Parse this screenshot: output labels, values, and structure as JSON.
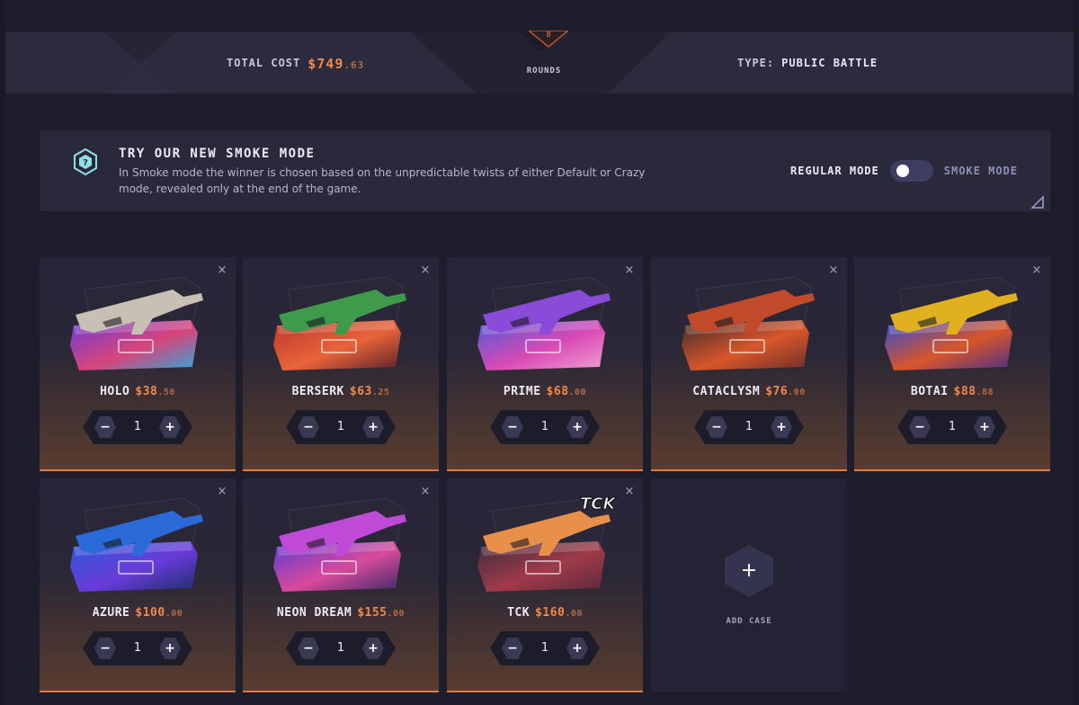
{
  "header": {
    "total_cost_label": "TOTAL COST",
    "total_cost_dollars": "$749",
    "total_cost_cents": ".63",
    "rounds_count": "8",
    "rounds_label": "ROUNDS",
    "type_label": "TYPE:",
    "type_value": "PUBLIC BATTLE"
  },
  "smoke_banner": {
    "title": "TRY OUR NEW SMOKE MODE",
    "description": "In Smoke mode the winner is chosen based on the unpredictable twists of either Default or Crazy mode, revealed only at the end of the game.",
    "regular_mode_label": "REGULAR MODE",
    "smoke_mode_label": "SMOKE MODE",
    "toggle_on": false
  },
  "cases": [
    {
      "name": "HOLO",
      "price": "$38",
      "cents": ".50",
      "qty": "1",
      "remove": "×",
      "minus": "−",
      "plus": "+",
      "crate": [
        "#6a3bd9",
        "#d7457a",
        "#2fa7d8"
      ],
      "gun": "#c8c0b4"
    },
    {
      "name": "BERSERK",
      "price": "$63",
      "cents": ".25",
      "qty": "1",
      "remove": "×",
      "minus": "−",
      "plus": "+",
      "crate": [
        "#b8352a",
        "#e8643a",
        "#5a1f2a"
      ],
      "gun": "#3f9a4b"
    },
    {
      "name": "PRIME",
      "price": "$68",
      "cents": ".00",
      "qty": "1",
      "remove": "×",
      "minus": "−",
      "plus": "+",
      "crate": [
        "#4a5bd8",
        "#d84ab6",
        "#f0a0d0"
      ],
      "gun": "#8a4bd8"
    },
    {
      "name": "CATACLYSM",
      "price": "$76",
      "cents": ".00",
      "qty": "1",
      "remove": "×",
      "minus": "−",
      "plus": "+",
      "crate": [
        "#3a2a2c",
        "#d8562a",
        "#6a2f2a"
      ],
      "gun": "#c04a2a"
    },
    {
      "name": "BOTAI",
      "price": "$88",
      "cents": ".88",
      "qty": "1",
      "remove": "×",
      "minus": "−",
      "plus": "+",
      "crate": [
        "#2a4bd8",
        "#d8562a",
        "#4a2f8a"
      ],
      "gun": "#e0b020"
    },
    {
      "name": "AZURE",
      "price": "$100",
      "cents": ".00",
      "qty": "1",
      "remove": "×",
      "minus": "−",
      "plus": "+",
      "crate": [
        "#2a5ad8",
        "#6a3bd9",
        "#1a2f6a"
      ],
      "gun": "#2a6ad8"
    },
    {
      "name": "NEON DREAM",
      "price": "$155",
      "cents": ".00",
      "qty": "1",
      "remove": "×",
      "minus": "−",
      "plus": "+",
      "crate": [
        "#5a3bd8",
        "#d84a9a",
        "#3a2a6a"
      ],
      "gun": "#c04ad8"
    },
    {
      "name": "TCK",
      "price": "$160",
      "cents": ".00",
      "qty": "1",
      "remove": "×",
      "minus": "−",
      "plus": "+",
      "crate": [
        "#3a2a3a",
        "#a03a4a",
        "#5a2a3a"
      ],
      "gun": "#e8904a",
      "logo": "TCK"
    }
  ],
  "add_case": {
    "icon": "+",
    "label": "ADD CASE"
  }
}
